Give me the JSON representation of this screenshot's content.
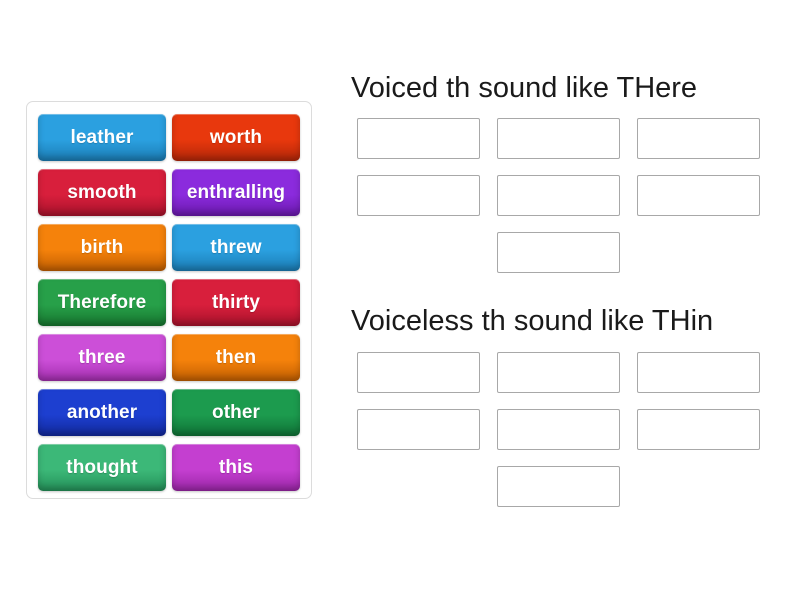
{
  "activity": {
    "type": "group-sort",
    "tray_label": "word-tiles"
  },
  "tiles": [
    {
      "label": "leather",
      "color": "#2ba0e0",
      "color_dark": "#1b7cb4"
    },
    {
      "label": "worth",
      "color": "#e8380d",
      "color_dark": "#b32709"
    },
    {
      "label": "smooth",
      "color": "#d81f3c",
      "color_dark": "#a8122b"
    },
    {
      "label": "enthralling",
      "color": "#8b2bdd",
      "color_dark": "#6a19ad"
    },
    {
      "label": "birth",
      "color": "#f5820b",
      "color_dark": "#c25f02"
    },
    {
      "label": "threw",
      "color": "#2ba0e0",
      "color_dark": "#1b7cb4"
    },
    {
      "label": "Therefore",
      "color": "#27a049",
      "color_dark": "#17762f"
    },
    {
      "label": "thirty",
      "color": "#d81f3c",
      "color_dark": "#a8122b"
    },
    {
      "label": "three",
      "color": "#cc4fd8",
      "color_dark": "#a32eae"
    },
    {
      "label": "then",
      "color": "#f5820b",
      "color_dark": "#c25f02"
    },
    {
      "label": "another",
      "color": "#1d3fd0",
      "color_dark": "#12299c"
    },
    {
      "label": "other",
      "color": "#1c9b4e",
      "color_dark": "#107337"
    },
    {
      "label": "thought",
      "color": "#3cb878",
      "color_dark": "#249159"
    },
    {
      "label": "this",
      "color": "#c43fd0",
      "color_dark": "#9b26a7"
    }
  ],
  "categories": [
    {
      "title": "Voiced th sound like THere",
      "slots": [
        "",
        "",
        "",
        "",
        "",
        "",
        ""
      ],
      "slot_count": 7
    },
    {
      "title": "Voiceless th sound like THin",
      "slots": [
        "",
        "",
        "",
        "",
        "",
        "",
        ""
      ],
      "slot_count": 7
    }
  ]
}
